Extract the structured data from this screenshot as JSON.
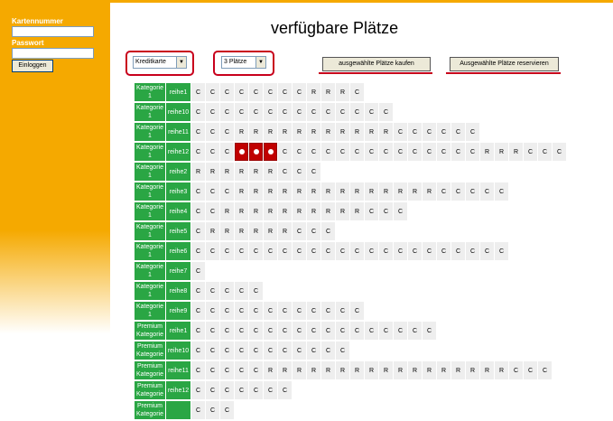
{
  "login": {
    "card_label": "Kartennummer",
    "password_label": "Passwort",
    "login_button": "Einloggen"
  },
  "page": {
    "title": "verfügbare Plätze"
  },
  "controls": {
    "payment_select": "Kreditkarte",
    "places_select": "3 Plätze",
    "buy_button": "ausgewählte Plätze kaufen",
    "reserve_button": "Ausgewählte Plätze reservieren"
  },
  "seat_legend": {
    "free": "C",
    "reserved": "R",
    "selected": "selected"
  },
  "rows": [
    {
      "cat": "Kategorie 1",
      "name": "reihe1",
      "seats": "CCCCCCCCRRRC"
    },
    {
      "cat": "Kategorie 1",
      "name": "reihe10",
      "seats": "CCCCCCCCCCCCCC"
    },
    {
      "cat": "Kategorie 1",
      "name": "reihe11",
      "seats": "CCCRRRRRRRRRRRCCCCCC"
    },
    {
      "cat": "Kategorie 1",
      "name": "reihe12",
      "seats": "CCCSSSCCCCCCCCCCCCCCRRRCCC"
    },
    {
      "cat": "Kategorie 1",
      "name": "reihe2",
      "seats": "RRRRRRCCC"
    },
    {
      "cat": "Kategorie 1",
      "name": "reihe3",
      "seats": "CCCRRRRRRRRRRRRRRCCCCC"
    },
    {
      "cat": "Kategorie 1",
      "name": "reihe4",
      "seats": "CCRRRRRRRRRRCCC"
    },
    {
      "cat": "Kategorie 1",
      "name": "reihe5",
      "seats": "CRRRRRRCCC"
    },
    {
      "cat": "Kategorie 1",
      "name": "reihe6",
      "seats": "CCCCCCCCCCCCCCCCCCCCCC"
    },
    {
      "cat": "Kategorie 1",
      "name": "reihe7",
      "seats": "C"
    },
    {
      "cat": "Kategorie 1",
      "name": "reihe8",
      "seats": "CCCCC"
    },
    {
      "cat": "Kategorie 1",
      "name": "reihe9",
      "seats": "CCCCCCCCCCCC"
    },
    {
      "cat": "Premium Kategorie",
      "name": "reihe1",
      "seats": "CCCCCCCCCCCCCCCCC"
    },
    {
      "cat": "Premium Kategorie",
      "name": "reihe10",
      "seats": "CCCCCCCCCCC"
    },
    {
      "cat": "Premium Kategorie",
      "name": "reihe11",
      "seats": "CCCCCRRRRRRRRRRRRRRRRRCCC"
    },
    {
      "cat": "Premium Kategorie",
      "name": "reihe12",
      "seats": "CCCCCCC"
    },
    {
      "cat": "Premium Kategorie",
      "name": "",
      "seats": "CCC"
    }
  ]
}
